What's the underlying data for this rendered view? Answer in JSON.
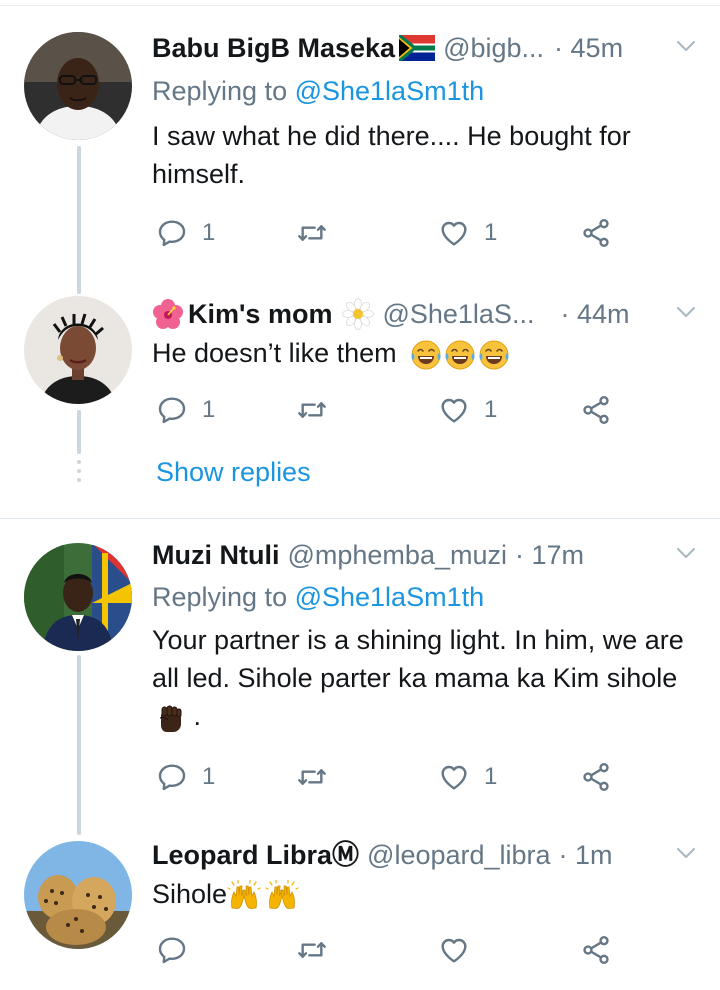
{
  "tweets": [
    {
      "name": "Babu BigB Maseka",
      "handle": "@bigb...",
      "time": "· 45m",
      "replying_prefix": "Replying to ",
      "replying_to": "@She1laSm1th",
      "text": "I saw what he did there.... He bought for himself.",
      "replies": "1",
      "retweets": "",
      "likes": "1"
    },
    {
      "name": "Kim's mom",
      "handle": "@She1laS...",
      "time": "· 44m",
      "text": "He doesn’t like them",
      "replies": "1",
      "retweets": "",
      "likes": "1",
      "show_replies": "Show replies"
    },
    {
      "name": "Muzi Ntuli",
      "handle": "@mphemba_muzi",
      "time": "· 17m",
      "replying_prefix": "Replying to ",
      "replying_to": "@She1laSm1th",
      "text": "Your partner is a shining light. In him, we are all led. Sihole parter ka mama ka Kim sihole",
      "text_suffix": " .",
      "replies": "1",
      "retweets": "",
      "likes": "1"
    },
    {
      "name": "Leopard Libra",
      "name_suffix": "Ⓜ",
      "handle": "@leopard_libra",
      "time": "· 1m",
      "text": "Sihole",
      "replies": "",
      "retweets": "",
      "likes": ""
    }
  ],
  "colors": {
    "name": "#14171a",
    "secondary": "#657786",
    "link": "#1b95e0",
    "thread_line": "#ccd6dd",
    "divider": "#e1e8ed"
  },
  "icons": {
    "reply": "speech-bubble-icon",
    "retweet": "retweet-arrows-icon",
    "like": "heart-outline-icon",
    "share": "share-nodes-icon",
    "menu": "chevron-down-icon",
    "flag": "south-africa-flag-emoji",
    "flower": "hibiscus-emoji",
    "blossom": "white-flower-emoji",
    "laugh": "tears-of-joy-emoji",
    "fist": "raised-fist-emoji",
    "hands": "raising-hands-emoji"
  }
}
